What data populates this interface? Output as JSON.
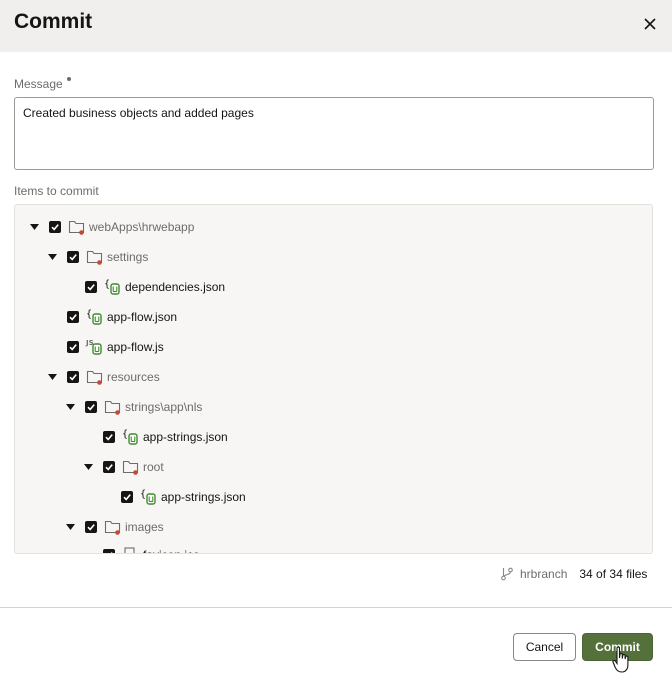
{
  "dialog": {
    "title": "Commit",
    "close_icon": "close-icon"
  },
  "message": {
    "label": "Message",
    "value": "Created business objects and added pages"
  },
  "items": {
    "label": "Items to commit",
    "tree": [
      {
        "label": "webApps\\hrwebapp",
        "type": "folder",
        "expanded": true,
        "checked": true
      },
      {
        "label": "settings",
        "type": "folder",
        "expanded": true,
        "checked": true
      },
      {
        "label": "dependencies.json",
        "type": "json",
        "checked": true
      },
      {
        "label": "app-flow.json",
        "type": "json",
        "checked": true
      },
      {
        "label": "app-flow.js",
        "type": "js",
        "checked": true
      },
      {
        "label": "resources",
        "type": "folder",
        "expanded": true,
        "checked": true
      },
      {
        "label": "strings\\app\\nls",
        "type": "folder",
        "expanded": true,
        "checked": true
      },
      {
        "label": "app-strings.json",
        "type": "json",
        "checked": true
      },
      {
        "label": "root",
        "type": "folder",
        "expanded": true,
        "checked": true
      },
      {
        "label": "app-strings.json",
        "type": "json",
        "checked": true
      },
      {
        "label": "images",
        "type": "folder",
        "expanded": true,
        "checked": true
      },
      {
        "label": "favicon.ico",
        "type": "file",
        "checked": true
      }
    ]
  },
  "branch": {
    "icon": "branch-icon",
    "name": "hrbranch",
    "count": "34 of 34 files"
  },
  "footer": {
    "cancel_label": "Cancel",
    "commit_label": "Commit"
  },
  "colors": {
    "primary": "#55713b",
    "header_bg": "#f1efed",
    "new_badge": "#3f8a2e",
    "modified_dot": "#c74634"
  }
}
